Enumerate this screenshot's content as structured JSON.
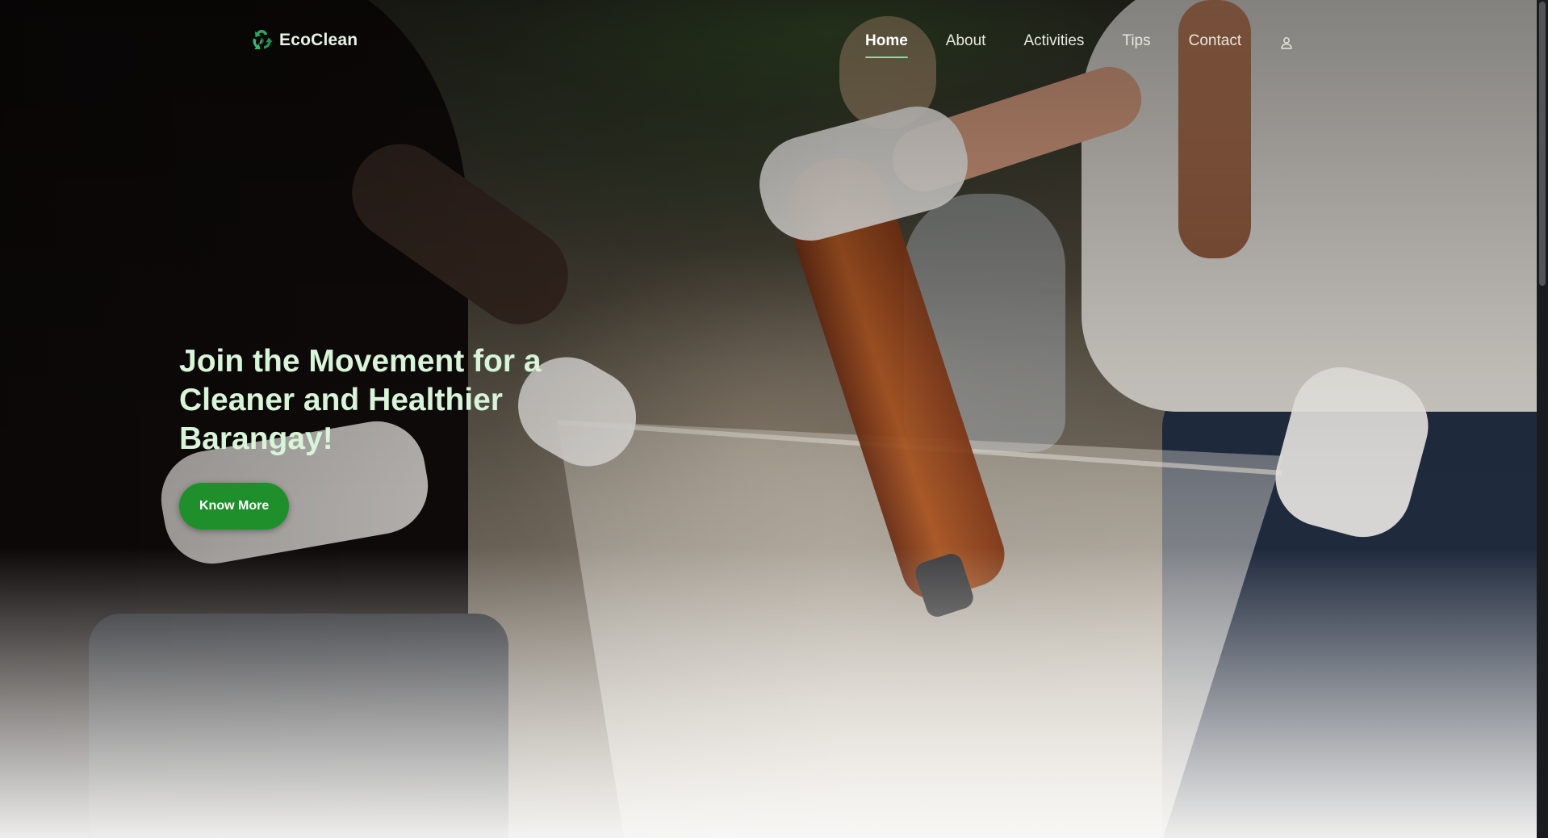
{
  "brand": {
    "name": "EcoClean",
    "icon": "recycle-leaf-icon"
  },
  "nav": {
    "items": [
      {
        "label": "Home",
        "active": true
      },
      {
        "label": "About",
        "active": false
      },
      {
        "label": "Activities",
        "active": false
      },
      {
        "label": "Tips",
        "active": false
      },
      {
        "label": "Contact",
        "active": false
      }
    ],
    "account_icon": "user-icon"
  },
  "hero": {
    "title": "Join the Movement for a Cleaner and Healthier Barangay!",
    "button_label": "Know More"
  },
  "colors": {
    "accent_green": "#1f8f2c",
    "title_green": "#d8f4d9",
    "active_underline": "#7fe0a6"
  }
}
